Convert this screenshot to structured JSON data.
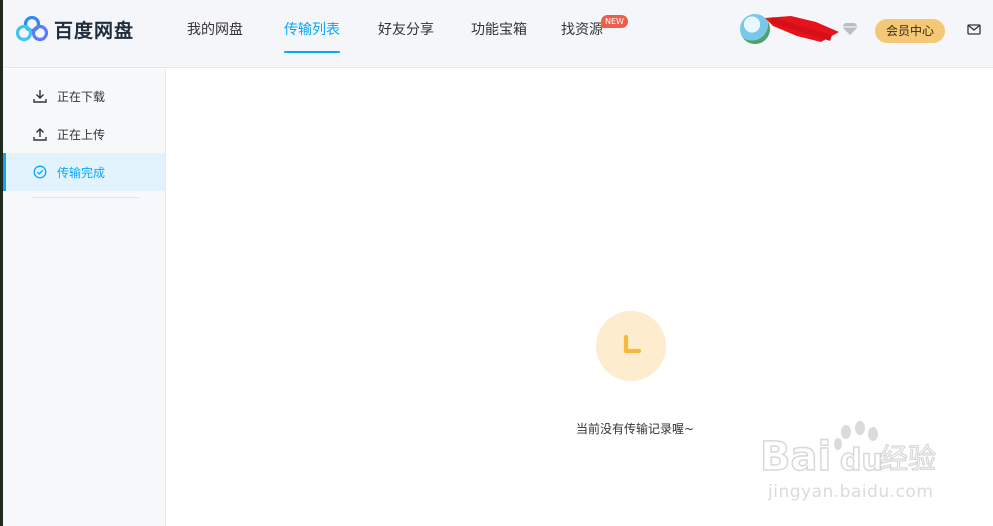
{
  "app": {
    "title": "百度网盘"
  },
  "nav": {
    "items": [
      {
        "label": "我的网盘"
      },
      {
        "label": "传输列表"
      },
      {
        "label": "好友分享"
      },
      {
        "label": "功能宝箱"
      },
      {
        "label": "找资源"
      }
    ],
    "active_index": 1,
    "new_badge": "NEW"
  },
  "header": {
    "vip_label": "会员中心"
  },
  "sidebar": {
    "items": [
      {
        "label": "正在下载",
        "icon": "download-icon"
      },
      {
        "label": "正在上传",
        "icon": "upload-icon"
      },
      {
        "label": "传输完成",
        "icon": "check-circle-icon"
      }
    ],
    "active_index": 2
  },
  "empty_state": {
    "message": "当前没有传输记录喔~",
    "icon": "clock-icon"
  },
  "watermark": {
    "text": "jingyan.baidu.com"
  },
  "colors": {
    "accent": "#06a7ff",
    "vip": "#f5c877",
    "empty_icon_bg": "#fdeccd",
    "empty_icon_fg": "#f5b93c",
    "new_badge": "#f25d4b"
  }
}
